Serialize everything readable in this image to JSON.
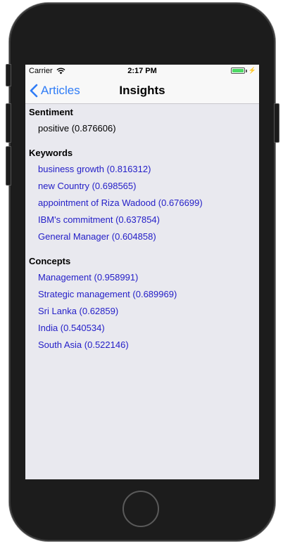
{
  "status": {
    "carrier": "Carrier",
    "time": "2:17 PM",
    "battery_level": 1.0,
    "charging_symbol": "⚡"
  },
  "nav": {
    "back_label": "Articles",
    "title": "Insights"
  },
  "sentiment": {
    "heading": "Sentiment",
    "value": "positive (0.876606)"
  },
  "keywords": {
    "heading": "Keywords",
    "items": [
      "business growth (0.816312)",
      "new Country (0.698565)",
      "appointment of Riza Wadood (0.676699)",
      "IBM's commitment (0.637854)",
      "General Manager (0.604858)"
    ]
  },
  "concepts": {
    "heading": "Concepts",
    "items": [
      "Management (0.958991)",
      "Strategic management (0.689969)",
      "Sri Lanka (0.62859)",
      "India (0.540534)",
      "South Asia (0.522146)"
    ]
  },
  "colors": {
    "accent": "#2f7cf6",
    "link": "#2520c8",
    "battery": "#4cd964",
    "background": "#e9e9ef"
  },
  "icons": {
    "back": "chevron-left-icon",
    "wifi": "wifi-icon",
    "battery": "battery-icon"
  }
}
